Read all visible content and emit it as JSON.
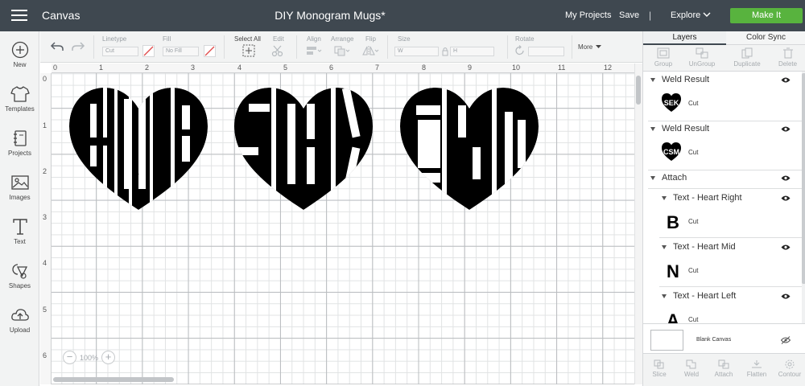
{
  "topbar": {
    "app_title": "Canvas",
    "doc_title": "DIY Monogram Mugs*",
    "my_projects": "My Projects",
    "save": "Save",
    "separator": "|",
    "explore": "Explore",
    "make_it": "Make It",
    "make_color": "#58b33e"
  },
  "leftbar": {
    "items": [
      {
        "label": "New",
        "icon": "plus-circle-icon"
      },
      {
        "label": "Templates",
        "icon": "tshirt-icon"
      },
      {
        "label": "Projects",
        "icon": "notebook-icon"
      },
      {
        "label": "Images",
        "icon": "image-icon"
      },
      {
        "label": "Text",
        "icon": "text-icon"
      },
      {
        "label": "Shapes",
        "icon": "shapes-icon"
      },
      {
        "label": "Upload",
        "icon": "cloud-upload-icon"
      }
    ]
  },
  "edit_toolbar": {
    "linetype_label": "Linetype",
    "linetype_value": "Cut",
    "fill_label": "Fill",
    "fill_value": "No Fill",
    "select_all": "Select All",
    "edit": "Edit",
    "align": "Align",
    "arrange": "Arrange",
    "flip": "Flip",
    "size": "Size",
    "size_w": "W",
    "size_h": "H",
    "rotate": "Rotate",
    "more": "More"
  },
  "ruler": {
    "top": [
      "0",
      "1",
      "2",
      "3",
      "4",
      "5",
      "6",
      "7",
      "8",
      "9",
      "10",
      "11",
      "12"
    ],
    "left": [
      "0",
      "1",
      "2",
      "3",
      "4",
      "5",
      "6"
    ]
  },
  "canvas": {
    "monograms": [
      "ANB",
      "SEK",
      "CSM"
    ],
    "zoom": "100%"
  },
  "right_panel": {
    "tabs": [
      "Layers",
      "Color Sync"
    ],
    "actions": [
      "Group",
      "UnGroup",
      "Duplicate",
      "Delete"
    ],
    "layers": [
      {
        "name": "Weld Result",
        "op": "Cut",
        "thumb_text": "SEK"
      },
      {
        "name": "Weld Result",
        "op": "Cut",
        "thumb_text": "CSM"
      },
      {
        "name": "Attach",
        "children": [
          {
            "name": "Text - Heart Right",
            "op": "Cut",
            "thumb_text": "B"
          },
          {
            "name": "Text - Heart Mid",
            "op": "Cut",
            "thumb_text": "N"
          },
          {
            "name": "Text - Heart Left",
            "op": "Cut",
            "thumb_text": "A"
          }
        ]
      }
    ],
    "blank_canvas": "Blank Canvas",
    "bottom_actions": [
      "Slice",
      "Weld",
      "Attach",
      "Flatten",
      "Contour"
    ]
  }
}
